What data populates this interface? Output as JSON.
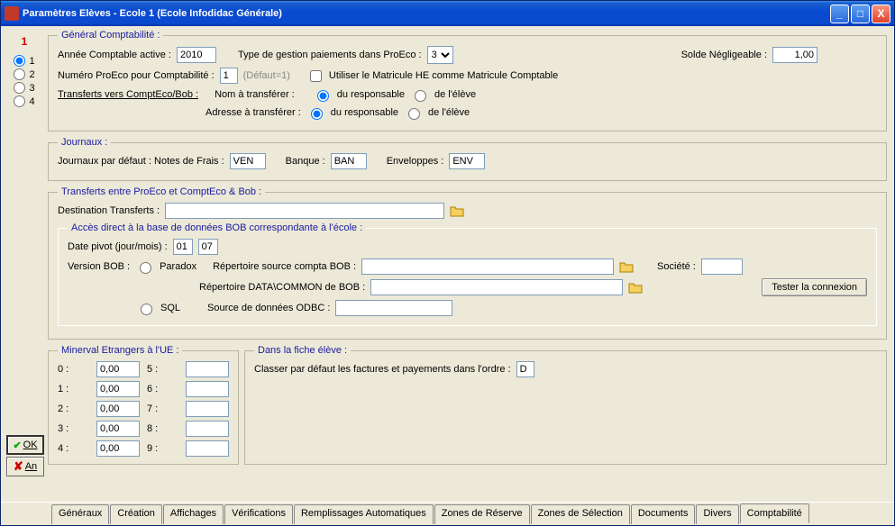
{
  "window": {
    "title": "Paramètres Elèves - Ecole 1 (Ecole Infodidac Générale)"
  },
  "sidebar": {
    "header": "1",
    "items": [
      "1",
      "2",
      "3",
      "4"
    ],
    "selected": 0
  },
  "general": {
    "legend": "Général Comptabilité :",
    "annee_lbl": "Année Comptable active :",
    "annee_val": "2010",
    "type_lbl": "Type de gestion paiements dans ProEco :",
    "type_val": "3",
    "solde_lbl": "Solde Négligeable :",
    "solde_val": "1,00",
    "numero_lbl": "Numéro ProEco pour Comptabilité :",
    "numero_val": "1",
    "numero_hint": "(Défaut=1)",
    "matricule_lbl": "Utiliser le Matricule HE comme Matricule Comptable",
    "transferts_lbl": "Transferts vers ComptEco/Bob :",
    "nom_lbl": "Nom à transférer :",
    "adr_lbl": "Adresse à transférer :",
    "opt_resp": "du responsable",
    "opt_eleve": "de l'élève"
  },
  "journaux": {
    "legend": "Journaux :",
    "defaut_lbl": "Journaux par défaut : Notes de Frais :",
    "notes_val": "VEN",
    "banque_lbl": "Banque :",
    "banque_val": "BAN",
    "env_lbl": "Enveloppes :",
    "env_val": "ENV"
  },
  "transferts": {
    "legend": "Transferts entre ProEco et ComptEco & Bob :",
    "dest_lbl": "Destination Transferts :",
    "dest_val": "",
    "acces_legend": "Accès direct à la base de données BOB correspondante à l'école :",
    "pivot_lbl": "Date pivot (jour/mois) :",
    "pivot_j": "01",
    "pivot_m": "07",
    "version_lbl": "Version BOB :",
    "opt_paradox": "Paradox",
    "opt_sql": "SQL",
    "rep_compta_lbl": "Répertoire source compta BOB :",
    "rep_compta_val": "",
    "societe_lbl": "Société :",
    "societe_val": "",
    "rep_common_lbl": "Répertoire DATA\\COMMON de BOB :",
    "rep_common_val": "",
    "tester_btn": "Tester la connexion",
    "odbc_lbl": "Source de données ODBC :",
    "odbc_val": ""
  },
  "minerval": {
    "legend": "Minerval Etrangers à l'UE :",
    "labels": [
      "0 :",
      "1 :",
      "2 :",
      "3 :",
      "4 :",
      "5 :",
      "6 :",
      "7 :",
      "8 :",
      "9 :"
    ],
    "values": [
      "0,00",
      "0,00",
      "0,00",
      "0,00",
      "0,00",
      "",
      "",
      "",
      "",
      ""
    ]
  },
  "fiche": {
    "legend": "Dans la fiche élève :",
    "classer_lbl": "Classer par défaut les factures et payements dans l'ordre :",
    "classer_val": "D"
  },
  "buttons": {
    "ok": "OK",
    "cancel": "An"
  },
  "tabs": {
    "items": [
      "Généraux",
      "Création",
      "Affichages",
      "Vérifications",
      "Remplissages Automatiques",
      "Zones de Réserve",
      "Zones de Sélection",
      "Documents",
      "Divers",
      "Comptabilité"
    ],
    "active": 9
  }
}
